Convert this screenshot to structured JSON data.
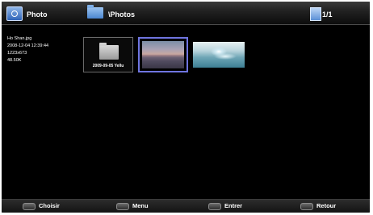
{
  "header": {
    "app_title": "Photo",
    "path": "\\Photos",
    "page_indicator": "1/1"
  },
  "file_info": {
    "filename": "Ho Shan.jpg",
    "datetime": "2008-12-04 12:39:44",
    "resolution": "1223x673",
    "size": "48.50K"
  },
  "thumbnails": [
    {
      "type": "folder",
      "caption": "2009-09-05 Yellu"
    },
    {
      "type": "image",
      "description": "sunset"
    },
    {
      "type": "image",
      "description": "water"
    }
  ],
  "footer": {
    "select_label": "Choisir",
    "menu_label": "Menu",
    "enter_label": "Entrer",
    "back_label": "Retour"
  },
  "colors": {
    "selection_border": "#6f75e0",
    "background": "#000000"
  }
}
